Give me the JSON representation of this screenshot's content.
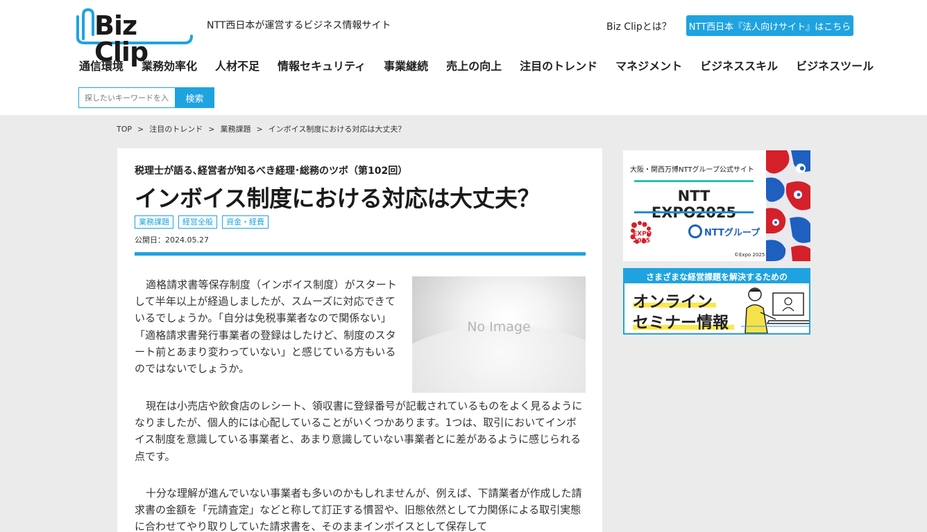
{
  "header": {
    "logo_text": "Biz Clip",
    "tagline": "NTT西日本が運営するビジネス情報サイト",
    "about_link": "Biz Clipとは？",
    "corp_button": "NTT西日本『法人向けサイト』はこちら"
  },
  "nav": {
    "items": [
      {
        "label": "通信環境"
      },
      {
        "label": "業務効率化"
      },
      {
        "label": "人材不足"
      },
      {
        "label": "情報セキュリティ"
      },
      {
        "label": "事業継続"
      },
      {
        "label": "売上の向上"
      },
      {
        "label": "注目のトレンド"
      },
      {
        "label": "マネジメント"
      },
      {
        "label": "ビジネススキル"
      },
      {
        "label": "ビジネスツール"
      }
    ]
  },
  "search": {
    "placeholder": "探したいキーワードを入力",
    "button": "検索"
  },
  "breadcrumb": {
    "items": [
      "TOP",
      "注目のトレンド",
      "業務課題",
      "インボイス制度における対応は大丈夫？"
    ],
    "separator": ">"
  },
  "article": {
    "series": "税理士が語る､経営者が知るべき経理･総務のツボ（第102回）",
    "title": "インボイス制度における対応は大丈夫？",
    "tags": [
      "業務課題",
      "経営全般",
      "資金・経費"
    ],
    "published": "公開日：2024.05.27",
    "image_text": "No Image",
    "paragraphs": [
      "適格請求書等保存制度（インボイス制度）がスタートして半年以上が経過しましたが、スムーズに対応できているでしょうか。「自分は免税事業者なので関係ない」「適格請求書発行事業者の登録はしたけど、制度のスタート前とあまり変わっていない」と感じている方もいるのではないでしょうか。",
      "現在は小売店や飲食店のレシート、領収書に登録番号が記載されているものをよく見るようになりましたが、個人的には心配していることがいくつかあります。1つは、取引においてインボイス制度を意識している事業者と、あまり意識していない事業者とに差があるように感じられる点です。",
      "十分な理解が進んでいない事業者も多いのかもしれませんが、例えば、下請業者が作成した請求書の金額を「元請査定」などと称して訂正する慣習や、旧態依然として力関係による取引実態に合わせてやり取りしていた請求書を、そのままインボイスとして保存して"
    ]
  },
  "sidebar": {
    "expo": {
      "subtitle": "大阪・関西万博NTTグループ公式サイト",
      "title": "NTT EXPO2025",
      "expo_logo": "EXPO\n2025",
      "group": "NTTグループ",
      "copyright": "©Expo 2025"
    },
    "seminar": {
      "header": "さまざまな経営課題を解決するための",
      "line1": "オンライン",
      "line2": "セミナー情報"
    }
  },
  "colors": {
    "accent": "#1fa3e0",
    "background": "#ebebeb"
  }
}
